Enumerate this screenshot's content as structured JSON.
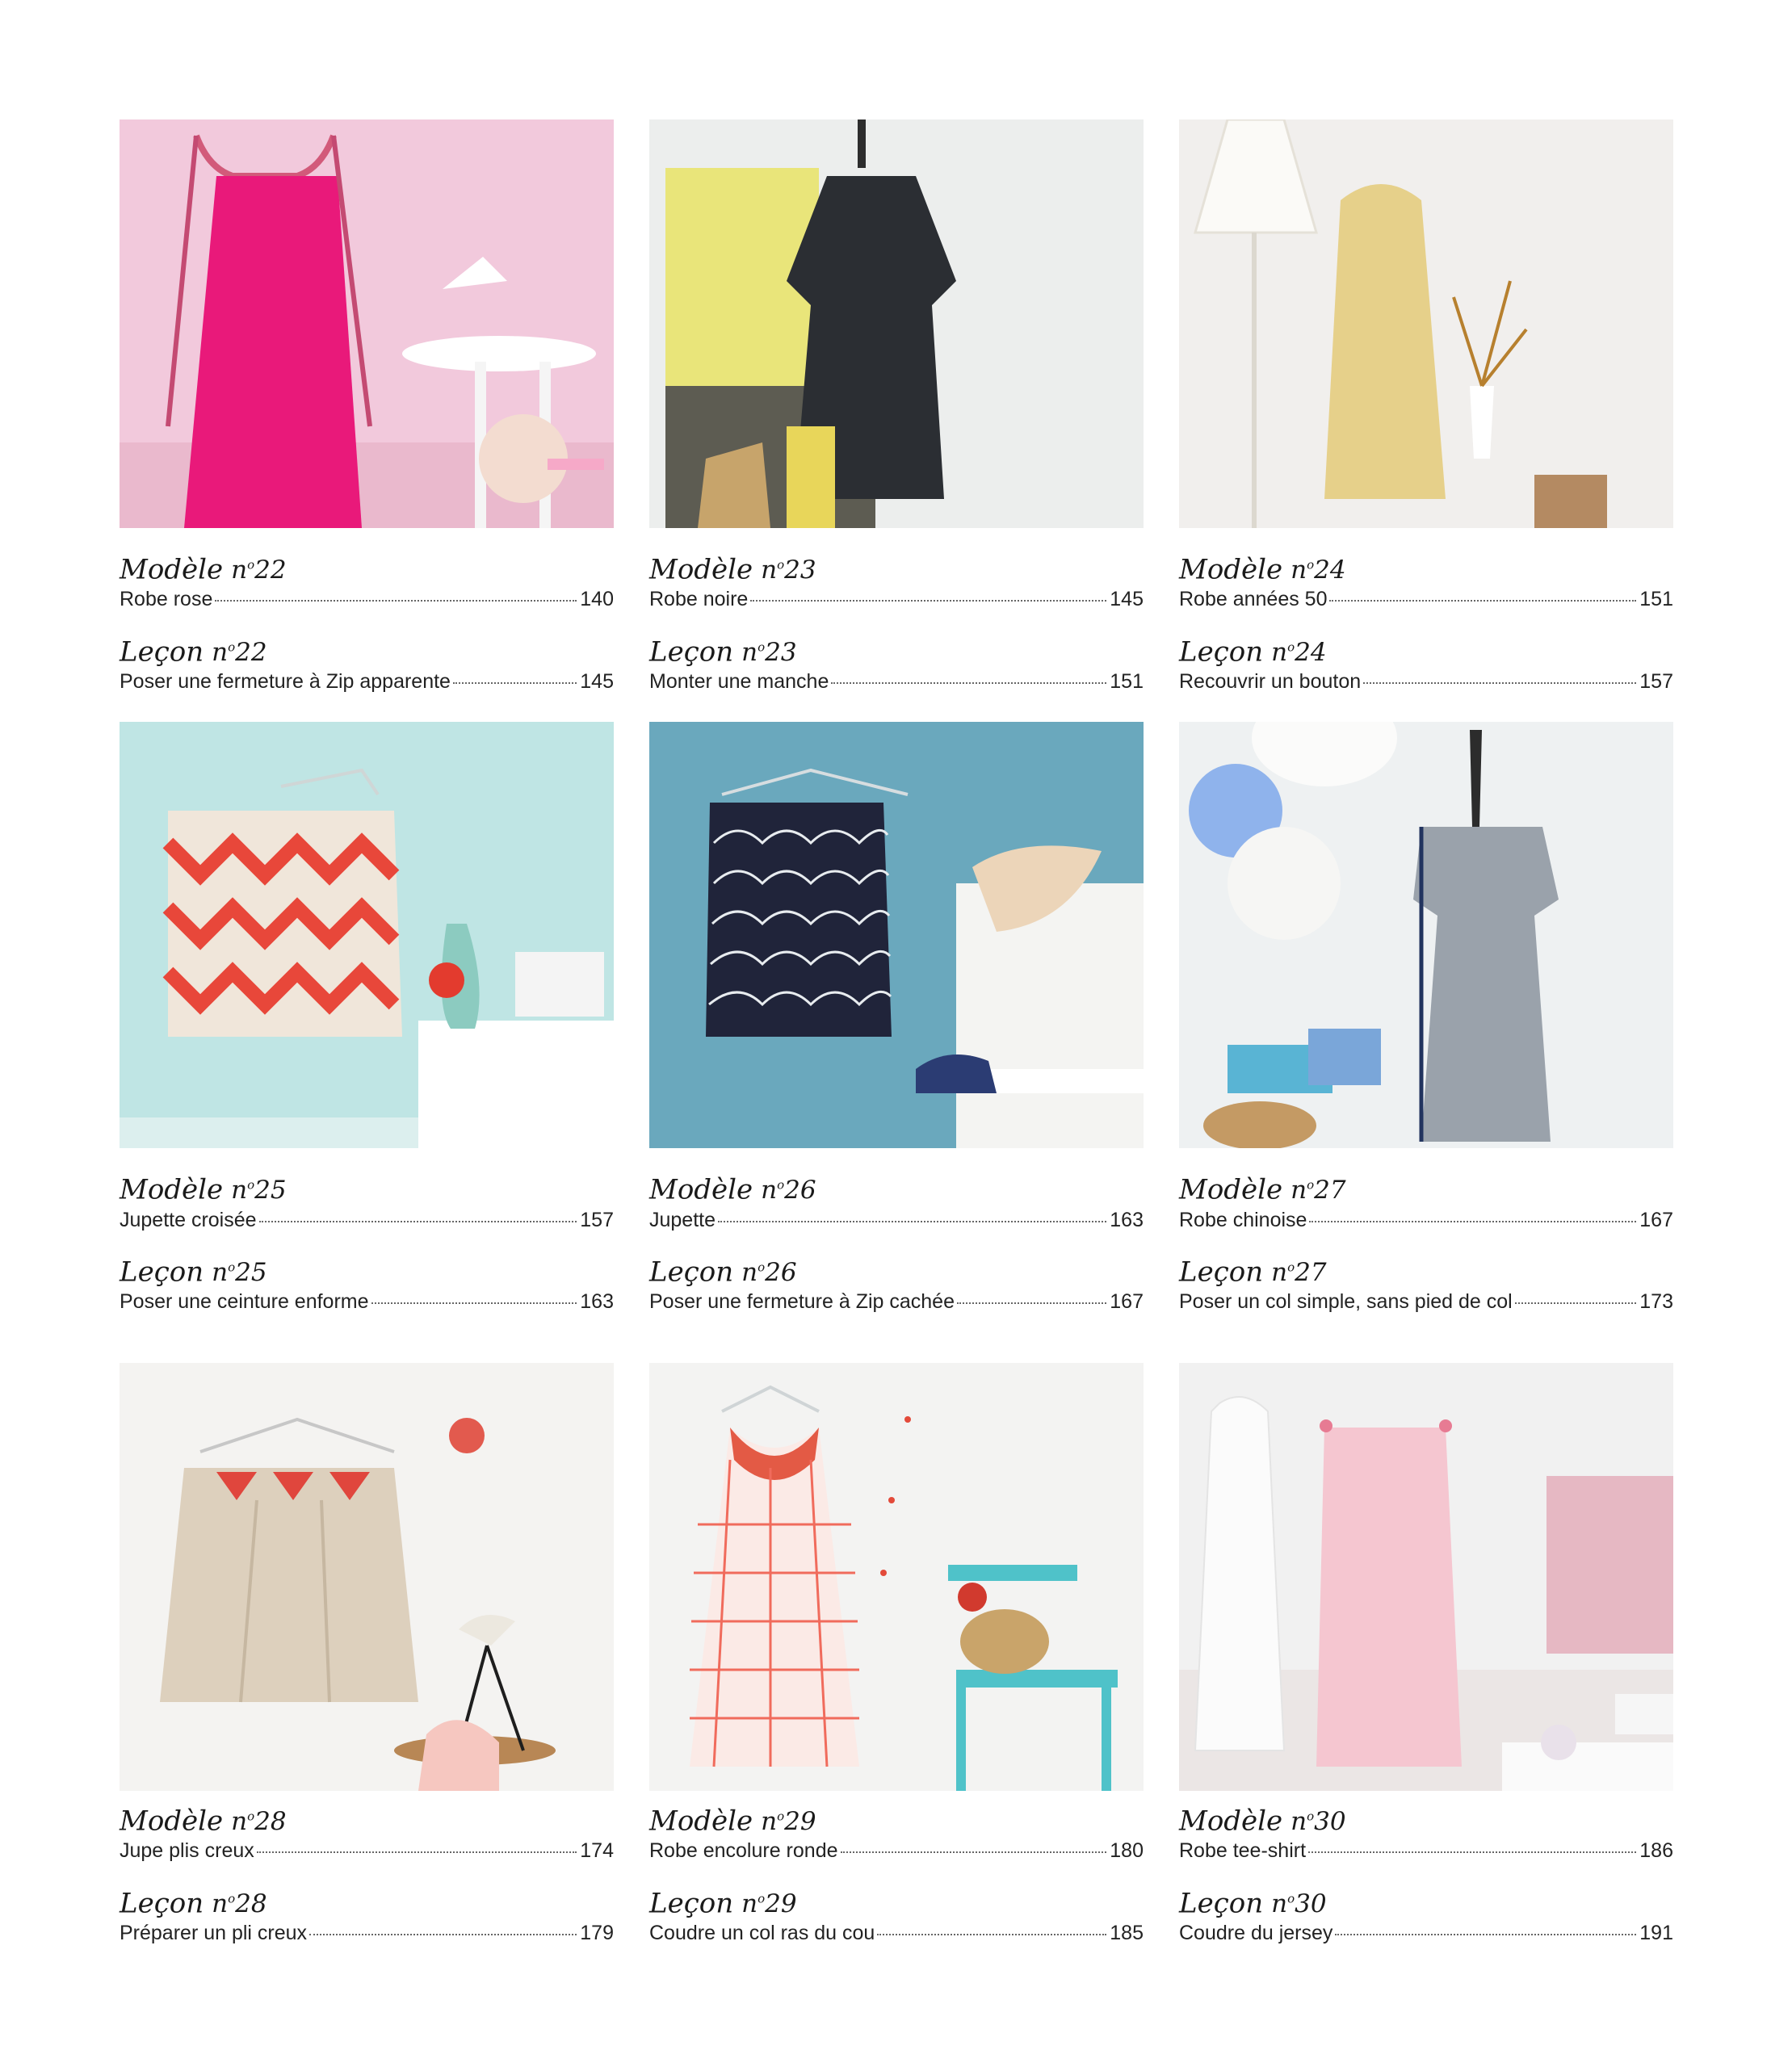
{
  "entries": [
    {
      "modele_word": "Modèle",
      "modele_num": "22",
      "modele_title": "Robe rose",
      "modele_page": "140",
      "lecon_word": "Leçon",
      "lecon_num": "22",
      "lecon_title": "Poser une fermeture à Zip apparente",
      "lecon_page": "145",
      "photo_colors": {
        "bg": "#f2c9dc",
        "garment": "#e9197a"
      }
    },
    {
      "modele_word": "Modèle",
      "modele_num": "23",
      "modele_title": "Robe noire",
      "modele_page": "145",
      "lecon_word": "Leçon",
      "lecon_num": "23",
      "lecon_title": "Monter une manche",
      "lecon_page": "151",
      "photo_colors": {
        "bg": "#eceeed",
        "garment": "#2b2e33"
      }
    },
    {
      "modele_word": "Modèle",
      "modele_num": "24",
      "modele_title": "Robe années 50",
      "modele_page": "151",
      "lecon_word": "Leçon",
      "lecon_num": "24",
      "lecon_title": "Recouvrir un bouton",
      "lecon_page": "157",
      "photo_colors": {
        "bg": "#f1efed",
        "garment": "#e6d08a"
      }
    },
    {
      "modele_word": "Modèle",
      "modele_num": "25",
      "modele_title": "Jupette croisée",
      "modele_page": "157",
      "lecon_word": "Leçon",
      "lecon_num": "25",
      "lecon_title": "Poser une ceinture enforme",
      "lecon_page": "163",
      "photo_colors": {
        "bg": "#bfe5e4",
        "garment": "#f0e6da"
      }
    },
    {
      "modele_word": "Modèle",
      "modele_num": "26",
      "modele_title": "Jupette",
      "modele_page": "163",
      "lecon_word": "Leçon",
      "lecon_num": "26",
      "lecon_title": "Poser une fermeture à Zip cachée",
      "lecon_page": "167",
      "photo_colors": {
        "bg": "#6aa8bd",
        "garment": "#20243a"
      }
    },
    {
      "modele_word": "Modèle",
      "modele_num": "27",
      "modele_title": "Robe chinoise",
      "modele_page": "167",
      "lecon_word": "Leçon",
      "lecon_num": "27",
      "lecon_title": "Poser un col simple, sans pied de col",
      "lecon_page": "173",
      "photo_colors": {
        "bg": "#eef1f2",
        "garment": "#9aa2ab"
      }
    },
    {
      "modele_word": "Modèle",
      "modele_num": "28",
      "modele_title": "Jupe plis creux",
      "modele_page": "174",
      "lecon_word": "Leçon",
      "lecon_num": "28",
      "lecon_title": "Préparer un pli creux",
      "lecon_page": "179",
      "photo_colors": {
        "bg": "#f4f3f1",
        "garment": "#ddd0bd"
      }
    },
    {
      "modele_word": "Modèle",
      "modele_num": "29",
      "modele_title": "Robe encolure ronde",
      "modele_page": "180",
      "lecon_word": "Leçon",
      "lecon_num": "29",
      "lecon_title": "Coudre un col ras du cou",
      "lecon_page": "185",
      "photo_colors": {
        "bg": "#f3f3f2",
        "garment": "#fbeae6"
      }
    },
    {
      "modele_word": "Modèle",
      "modele_num": "30",
      "modele_title": "Robe tee-shirt",
      "modele_page": "186",
      "lecon_word": "Leçon",
      "lecon_num": "30",
      "lecon_title": "Coudre du jersey",
      "lecon_page": "191",
      "photo_colors": {
        "bg": "#f1f1f1",
        "garment": "#f5c6d0"
      }
    }
  ]
}
